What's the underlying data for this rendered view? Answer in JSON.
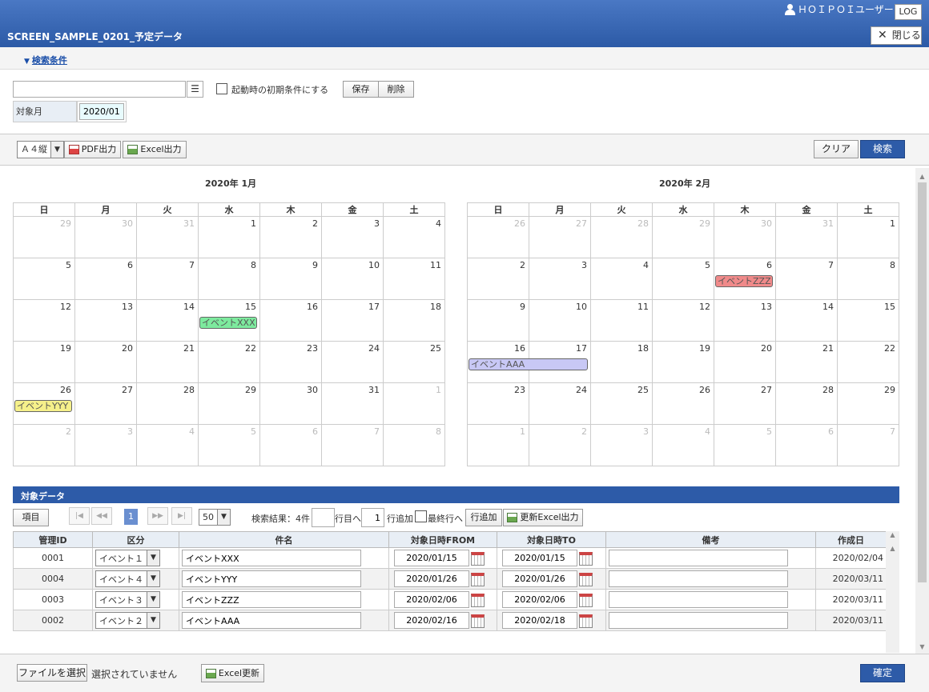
{
  "header": {
    "title": "SCREEN_SAMPLE_0201_予定データ",
    "user": "ＨＯＩＰＯＩユーザー",
    "log_label": "LOG",
    "close_label": "閉じる"
  },
  "search": {
    "toggle_label": "検索条件",
    "preset_value": "",
    "startup_checkbox_label": "起動時の初期条件にする",
    "save_label": "保存",
    "delete_label": "削除",
    "target_month_label": "対象月",
    "target_month_value": "2020/01"
  },
  "toolbar": {
    "paper_value": "Ａ４縦",
    "pdf_label": "PDF出力",
    "excel_label": "Excel出力",
    "clear_label": "クリア",
    "search_label": "検索"
  },
  "calendars": [
    {
      "title": "2020年 1月",
      "weekdays": [
        "日",
        "月",
        "火",
        "水",
        "木",
        "金",
        "土"
      ],
      "weeks": [
        [
          "29",
          "30",
          "31",
          "1",
          "2",
          "3",
          "4"
        ],
        [
          "5",
          "6",
          "7",
          "8",
          "9",
          "10",
          "11"
        ],
        [
          "12",
          "13",
          "14",
          "15",
          "16",
          "17",
          "18"
        ],
        [
          "19",
          "20",
          "21",
          "22",
          "23",
          "24",
          "25"
        ],
        [
          "26",
          "27",
          "28",
          "29",
          "30",
          "31",
          "1"
        ],
        [
          "2",
          "3",
          "4",
          "5",
          "6",
          "7",
          "8"
        ]
      ],
      "events": [
        {
          "label": "イベントXXX",
          "color": "#7dea9e"
        },
        {
          "label": "イベントYYY",
          "color": "#f5f08a"
        }
      ]
    },
    {
      "title": "2020年 2月",
      "weekdays": [
        "日",
        "月",
        "火",
        "水",
        "木",
        "金",
        "土"
      ],
      "weeks": [
        [
          "26",
          "27",
          "28",
          "29",
          "30",
          "31",
          "1"
        ],
        [
          "2",
          "3",
          "4",
          "5",
          "6",
          "7",
          "8"
        ],
        [
          "9",
          "10",
          "11",
          "12",
          "13",
          "14",
          "15"
        ],
        [
          "16",
          "17",
          "18",
          "19",
          "20",
          "21",
          "22"
        ],
        [
          "23",
          "24",
          "25",
          "26",
          "27",
          "28",
          "29"
        ],
        [
          "1",
          "2",
          "3",
          "4",
          "5",
          "6",
          "7"
        ]
      ],
      "events": [
        {
          "label": "イベントZZZ",
          "color": "#f08a8a"
        },
        {
          "label": "イベントAAA",
          "color": "#c8c8f5"
        }
      ]
    }
  ],
  "data_section": {
    "title": "対象データ",
    "items_label": "項目",
    "page": "1",
    "per_page": "50",
    "result_text": "検索結果：4件",
    "goto_suffix": "行目へ",
    "add_count": "1",
    "add_suffix": "行追加",
    "last_row_label": "最終行へ",
    "add_row_label": "行追加",
    "update_excel_label": "更新Excel出力",
    "columns": [
      "管理ID",
      "区分",
      "件名",
      "対象日時FROM",
      "対象日時TO",
      "備考",
      "作成日"
    ],
    "rows": [
      {
        "id": "0001",
        "kind": "イベント１",
        "name": "イベントXXX",
        "from": "2020/01/15",
        "to": "2020/01/15",
        "note": "",
        "created": "2020/02/04"
      },
      {
        "id": "0004",
        "kind": "イベント４",
        "name": "イベントYYY",
        "from": "2020/01/26",
        "to": "2020/01/26",
        "note": "",
        "created": "2020/03/11"
      },
      {
        "id": "0003",
        "kind": "イベント３",
        "name": "イベントZZZ",
        "from": "2020/02/06",
        "to": "2020/02/06",
        "note": "",
        "created": "2020/03/11"
      },
      {
        "id": "0002",
        "kind": "イベント２",
        "name": "イベントAAA",
        "from": "2020/02/16",
        "to": "2020/02/18",
        "note": "",
        "created": "2020/03/11"
      }
    ]
  },
  "footer": {
    "file_select_label": "ファイルを選択",
    "file_status": "選択されていません",
    "excel_update_label": "Excel更新",
    "confirm_label": "確定"
  }
}
